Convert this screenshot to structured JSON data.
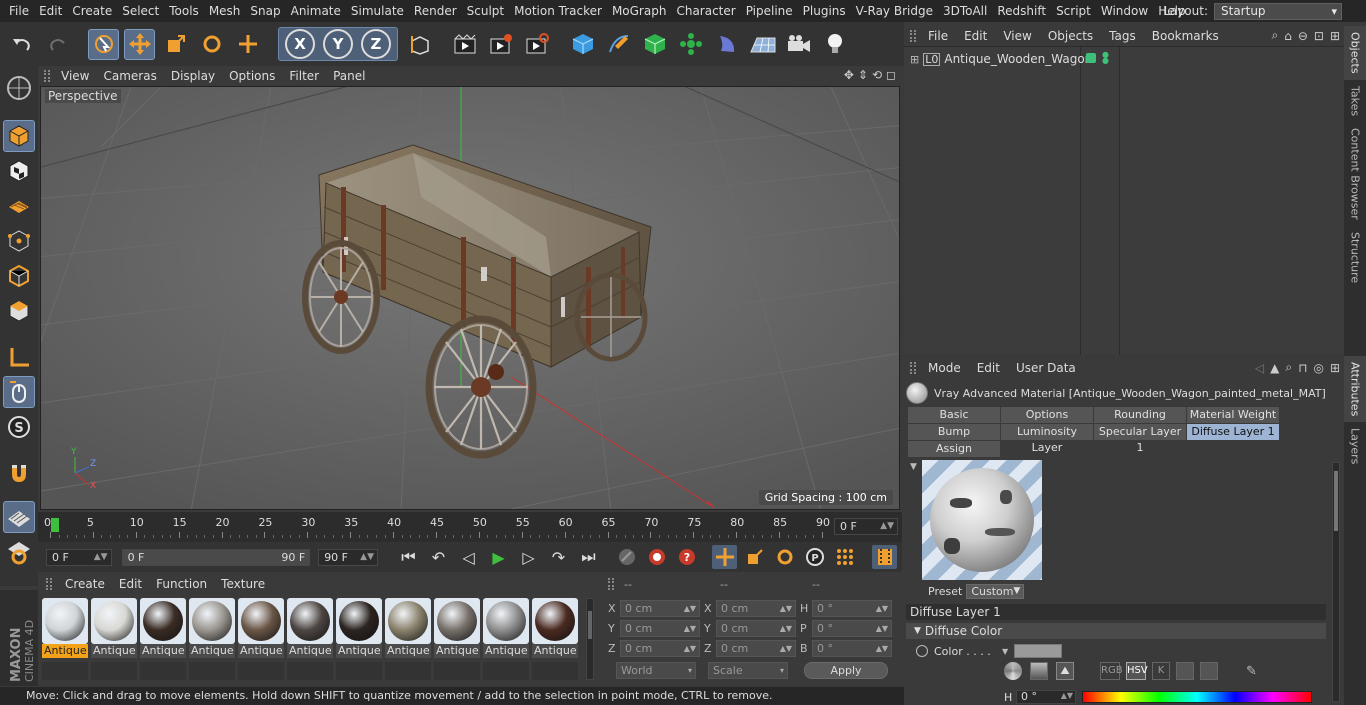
{
  "menubar": {
    "items": [
      "File",
      "Edit",
      "Create",
      "Select",
      "Tools",
      "Mesh",
      "Snap",
      "Animate",
      "Simulate",
      "Render",
      "Sculpt",
      "Motion Tracker",
      "MoGraph",
      "Character",
      "Pipeline",
      "Plugins",
      "V-Ray Bridge",
      "3DToAll",
      "Redshift",
      "Script",
      "Window",
      "Help"
    ],
    "layout_label": "Layout:",
    "layout_value": "Startup"
  },
  "toolbar": {
    "axis_x": "X",
    "axis_y": "Y",
    "axis_z": "Z"
  },
  "viewport": {
    "menu": [
      "View",
      "Cameras",
      "Display",
      "Options",
      "Filter",
      "Panel"
    ],
    "label": "Perspective",
    "grid_spacing": "Grid Spacing : 100 cm",
    "axis_y": "Y",
    "axis_z": "Z",
    "axis_x": "X"
  },
  "timeline": {
    "ticks": [
      "0",
      "5",
      "10",
      "15",
      "20",
      "25",
      "30",
      "35",
      "40",
      "45",
      "50",
      "55",
      "60",
      "65",
      "70",
      "75",
      "80",
      "85",
      "90"
    ],
    "current_frame": "0 F"
  },
  "transport": {
    "start_frame": "0 F",
    "range_start": "0 F",
    "range_end": "90 F",
    "end_frame": "90 F"
  },
  "material_manager": {
    "menu": [
      "Create",
      "Edit",
      "Function",
      "Texture"
    ],
    "materials": [
      {
        "label": "Antique",
        "tone": "#cfd4d6",
        "selected": true
      },
      {
        "label": "Antique",
        "tone": "#d8d8d4",
        "selected": false
      },
      {
        "label": "Antique",
        "tone": "#3a2c24",
        "selected": false
      },
      {
        "label": "Antique",
        "tone": "#9a9690",
        "selected": false
      },
      {
        "label": "Antique",
        "tone": "#6a5646",
        "selected": false
      },
      {
        "label": "Antique",
        "tone": "#4e4642",
        "selected": false
      },
      {
        "label": "Antique",
        "tone": "#2c2420",
        "selected": false
      },
      {
        "label": "Antique",
        "tone": "#8a826c",
        "selected": false
      },
      {
        "label": "Antique",
        "tone": "#77706a",
        "selected": false
      },
      {
        "label": "Antique",
        "tone": "#8e8e8e",
        "selected": false
      },
      {
        "label": "Antique",
        "tone": "#4a2a20",
        "selected": false
      }
    ]
  },
  "coords": {
    "headers": [
      "--",
      "--",
      "--"
    ],
    "rows": [
      {
        "a": "X",
        "av": "0 cm",
        "b": "X",
        "bv": "0 cm",
        "c": "H",
        "cv": "0 °"
      },
      {
        "a": "Y",
        "av": "0 cm",
        "b": "Y",
        "bv": "0 cm",
        "c": "P",
        "cv": "0 °"
      },
      {
        "a": "Z",
        "av": "0 cm",
        "b": "Z",
        "bv": "0 cm",
        "c": "B",
        "cv": "0 °"
      }
    ],
    "mode_world": "World",
    "mode_scale": "Scale",
    "apply": "Apply"
  },
  "status": {
    "text": "Move: Click and drag to move elements. Hold down SHIFT to quantize movement / add to the selection in point mode, CTRL to remove."
  },
  "objects": {
    "menu": [
      "File",
      "Edit",
      "View",
      "Objects",
      "Tags",
      "Bookmarks"
    ],
    "object_name": "Antique_Wooden_Wagon"
  },
  "right_tabs": {
    "top": [
      "Objects",
      "Takes",
      "Content Browser",
      "Structure"
    ],
    "bottom": [
      "Attributes",
      "Layers"
    ]
  },
  "attributes": {
    "menu": [
      "Mode",
      "Edit",
      "User Data"
    ],
    "title": "Vray Advanced Material [Antique_Wooden_Wagon_painted_metal_MAT]",
    "tabs_row1": [
      "Basic",
      "Options",
      "Rounding",
      "Material Weight"
    ],
    "tabs_row2": [
      "Bump",
      "Luminosity Layer",
      "Specular Layer 1",
      "Diffuse Layer 1"
    ],
    "tabs_row3": [
      "Assign"
    ],
    "active_tab": "Diffuse Layer 1",
    "preset_label": "Preset",
    "preset_value": "Custom",
    "section_title": "Diffuse Layer 1",
    "subsection_title": "Diffuse Color",
    "color_label": "Color . . . .",
    "color_modes": [
      "RGB",
      "HSV",
      "K"
    ],
    "h_label": "H",
    "h_value": "0 °"
  }
}
